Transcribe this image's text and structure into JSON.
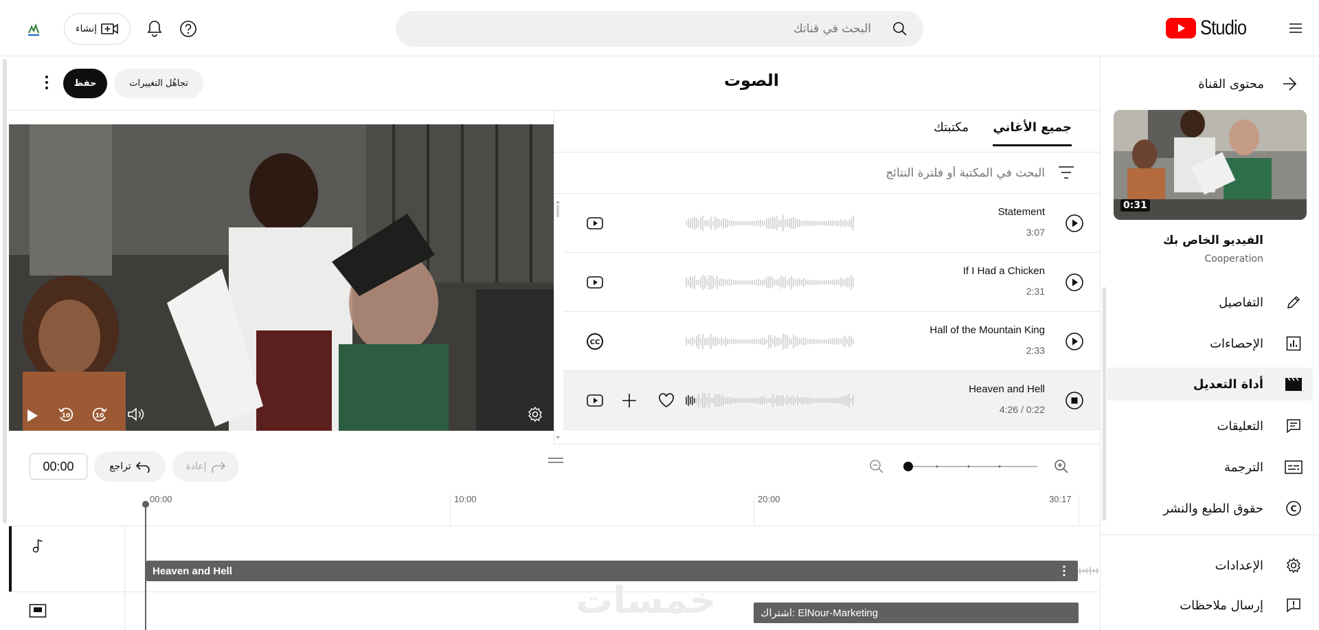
{
  "header": {
    "logo_text": "Studio",
    "search_placeholder": "البحث في قناتك",
    "create_label": "إنشاء"
  },
  "sidebar": {
    "channel_content": "محتوى القناة",
    "video_duration": "0:31",
    "your_video": "الفيديو الخاص بك",
    "video_name": "Cooperation",
    "items": [
      {
        "label": "التفاصيل",
        "icon": "pencil-icon",
        "active": false
      },
      {
        "label": "الإحصاءات",
        "icon": "analytics-icon",
        "active": false
      },
      {
        "label": "أداة التعديل",
        "icon": "editor-icon",
        "active": true
      },
      {
        "label": "التعليقات",
        "icon": "comments-icon",
        "active": false
      },
      {
        "label": "الترجمة",
        "icon": "subtitles-icon",
        "active": false
      },
      {
        "label": "حقوق الطبع والنشر",
        "icon": "copyright-icon",
        "active": false
      }
    ],
    "bottom_items": [
      {
        "label": "الإعدادات",
        "icon": "gear-icon"
      },
      {
        "label": "إرسال ملاحظات",
        "icon": "feedback-icon"
      }
    ]
  },
  "main": {
    "title": "الصوت",
    "save_label": "حفظ",
    "discard_label": "تجاهُل التغييرات"
  },
  "audio_panel": {
    "tabs": [
      {
        "label": "جميع الأغاني",
        "active": true
      },
      {
        "label": "مكتبتك",
        "active": false
      }
    ],
    "filter_placeholder": "البحث في المكتبة أو فلترة النتائج",
    "tracks": [
      {
        "name": "Statement",
        "duration": "3:07",
        "source_icon": "youtube-icon",
        "playing": false
      },
      {
        "name": "If I Had a Chicken",
        "duration": "2:31",
        "source_icon": "youtube-icon",
        "playing": false
      },
      {
        "name": "Hall of the Mountain King",
        "duration": "2:33",
        "source_icon": "creative-commons-icon",
        "playing": false
      },
      {
        "name": "Heaven and Hell",
        "duration": "4:26 / 0:22",
        "source_icon": "youtube-icon",
        "playing": true
      }
    ]
  },
  "timeline": {
    "time_value": "00:00",
    "undo_label": "تراجع",
    "redo_label": "إعادة",
    "ruler": [
      "00:00",
      "10:00",
      "20:00",
      "30:17"
    ],
    "audio_clip": "Heaven and Hell",
    "subscribe_clip": "اشتراك: ElNour-Marketing",
    "watermark": "خمسات"
  }
}
